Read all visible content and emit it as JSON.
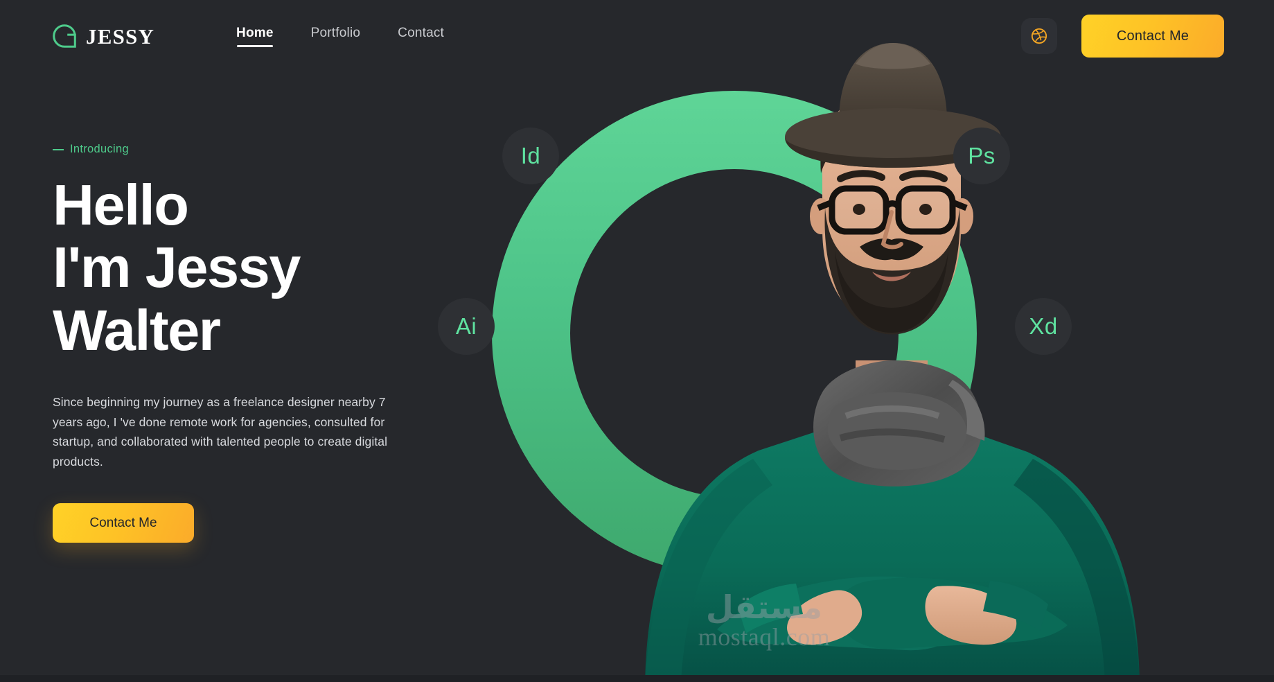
{
  "site": {
    "background_color": "#26282c",
    "accent_green": "#4ecb8b",
    "accent_yellow": "#fec326",
    "accent_orange": "#f5a623"
  },
  "header": {
    "brand": {
      "logo_icon": "g-monogram-icon",
      "name": "JESSY"
    },
    "nav": [
      {
        "label": "Home",
        "active": true
      },
      {
        "label": "Portfolio",
        "active": false
      },
      {
        "label": "Contact",
        "active": false
      }
    ],
    "social": {
      "icon": "dribbble-icon",
      "color": "#f5a623"
    },
    "cta_label": "Contact Me"
  },
  "hero": {
    "eyebrow": "Introducing",
    "headline_lines": [
      "Hello",
      "I'm Jessy",
      "Walter"
    ],
    "description": "Since beginning my journey as a freelance designer nearby 7 years ago, I 've done remote work for agencies, consulted for startup, and collaborated with talented people to create digital products.",
    "cta_label": "Contact Me"
  },
  "showcase": {
    "badges": [
      {
        "label": "Id",
        "name": "indesign"
      },
      {
        "label": "Ps",
        "name": "photoshop"
      },
      {
        "label": "Ai",
        "name": "illustrator"
      },
      {
        "label": "Xd",
        "name": "adobe-xd"
      }
    ],
    "ring_gradient_top": "#5fd597",
    "ring_gradient_bottom": "#3ea86d",
    "portrait_alt": "Bearded man with hat, glasses, scarf and green sweater, arms crossed"
  },
  "watermark": {
    "arabic": "مستقل",
    "latin": "mostaql.com"
  }
}
